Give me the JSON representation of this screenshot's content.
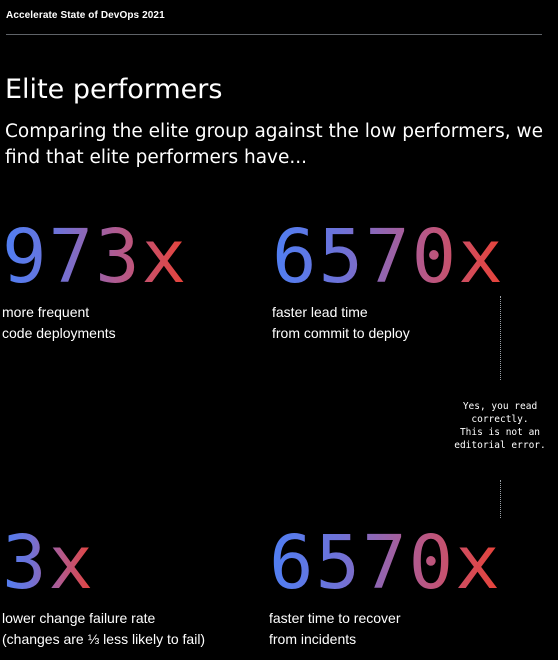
{
  "header": {
    "report_title": "Accelerate State of DevOps 2021"
  },
  "main": {
    "heading": "Elite performers",
    "intro": "Comparing the elite group against the low performers, we find that elite performers have..."
  },
  "stats": {
    "deploy": {
      "value": "973x",
      "caption_line1": "more frequent",
      "caption_line2": "code deployments"
    },
    "lead_time": {
      "value": "6570x",
      "caption_line1": "faster lead time",
      "caption_line2": "from commit to deploy"
    },
    "failure": {
      "value": "3x",
      "caption_line1": "lower change failure rate",
      "caption_line2": "(changes are ⅓ less likely to fail)"
    },
    "recover": {
      "value": "6570x",
      "caption_line1": "faster time to recover",
      "caption_line2": "from incidents"
    }
  },
  "note": {
    "line1": "Yes, you read",
    "line2": "correctly.",
    "line3": "This is not an",
    "line4": "editorial error."
  },
  "colors": {
    "background": "#000000",
    "text": "#ffffff",
    "gradient_start": "#4f7ff4",
    "gradient_mid": "#b15a8f",
    "gradient_end": "#ea4235",
    "rule": "#5f6368"
  }
}
